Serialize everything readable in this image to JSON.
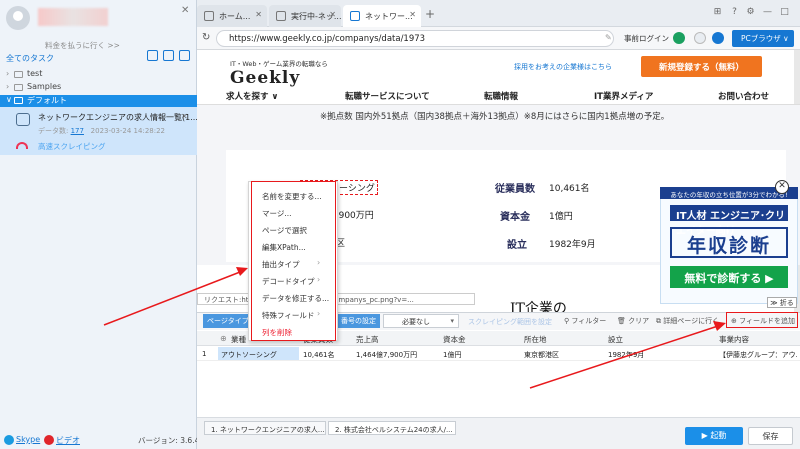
{
  "sidebar": {
    "pay_link": "料金を払うに行く >>",
    "task_header": "全てのタスク",
    "tree": [
      {
        "label": "test"
      },
      {
        "label": "Samples"
      },
      {
        "label": "デフォルト"
      }
    ],
    "task": {
      "name": "ネットワークエンジニアの求人情報一覧(1...",
      "data_label": "データ数:",
      "count": "177",
      "timestamp": "2023-03-24 14:28:22",
      "mode": "高速スクレイピング"
    },
    "footer": {
      "skype": "Skype",
      "video": "ビデオ",
      "version": "バージョン: 3.6.4"
    }
  },
  "browser": {
    "tabs": [
      {
        "label": "ホーム..."
      },
      {
        "label": "実行中-ネッ..."
      },
      {
        "label": "ネットワー..."
      }
    ],
    "url": "https://www.geekly.co.jp/companys/data/1973",
    "pre_login": "事前ログイン",
    "pc_browser": "PCブラウザ"
  },
  "site": {
    "logo_sub": "IT・Web・ゲーム業界の転職なら",
    "logo": "Geekly",
    "corp_link": "採用をお考えの企業様はこちら",
    "register": "新規登録する（無料）",
    "nav": [
      "求人を探す ∨",
      "転職サービスについて",
      "転職情報",
      "IT業界メディア",
      "お問い合わせ"
    ],
    "office_note": "※拠点数 国内外51拠点（国内38拠点＋海外13拠点）※8月にはさらに国内1拠点増の予定。",
    "info": {
      "industry_label": "業種",
      "industry_value": "アウトソーシング",
      "capital_partial": "1,900万円",
      "location_partial": "区",
      "employees_label": "従業員数",
      "employees_value": "10,461名",
      "capital_label": "資本金",
      "capital_value": "1億円",
      "founded_label": "設立",
      "founded_value": "1982年9月"
    },
    "request_bar": "リクエスト:http...                 ch/banner_review_companys_pc.png?v=...",
    "it_heading": "IT企業の",
    "ad": {
      "top": "あなたの年収の立ち位置が3分でわかる!",
      "title1": "IT人材 エンジニア･クリエイター向け",
      "title2": "年収診断",
      "cta": "無料で診断する ▶",
      "collapse": "≫ 折る"
    }
  },
  "context_menu": {
    "items": [
      "名前を変更する...",
      "マージ...",
      "ページで選択",
      "編集XPath...",
      "抽出タイプ",
      "デコードタイプ",
      "データを修正する...",
      "特殊フィールド",
      "列を削除"
    ]
  },
  "data_panel": {
    "page_type": "ページタイプ",
    "set_number": "番号の設定",
    "select_value": "必要なし",
    "scroll_range": "スクレイピング範囲を設定",
    "filter": "フィルター",
    "clear": "クリア",
    "detail": "詳細ページに行く",
    "add_field": "フィールドを追加",
    "columns": [
      "業種",
      "従業員数",
      "売上高",
      "資本金",
      "所在地",
      "設立",
      "事業内容"
    ],
    "rows": [
      {
        "index": "1",
        "cells": [
          "アウトソーシング",
          "10,461名",
          "1,464億7,900万円",
          "1億円",
          "東京都港区",
          "1982年9月",
          "【伊藤忠グループ：アウ..."
        ]
      }
    ]
  },
  "bottom": {
    "tabs": [
      "1. ネットワークエンジニアの求人...",
      "2. 株式会社ベルシステム24の求人/..."
    ],
    "start": "起動",
    "save": "保存"
  },
  "colors": {
    "accent": "#1b8fe8",
    "highlight_red": "#e8191c",
    "brand_orange": "#f0741f"
  }
}
